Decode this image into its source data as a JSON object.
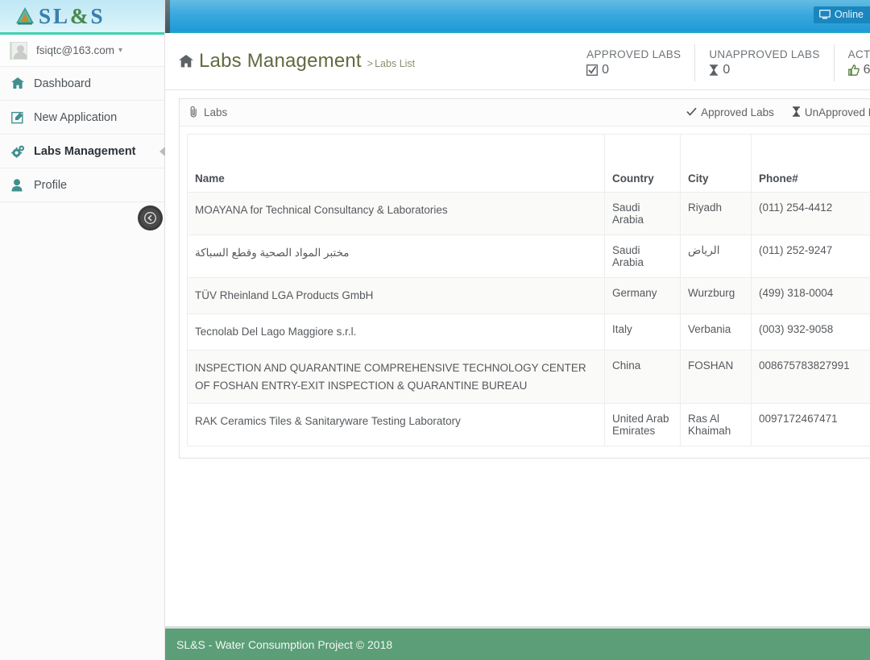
{
  "brand": {
    "name": "SL&S",
    "letters": [
      "S",
      "L",
      "&",
      "S"
    ],
    "logo_icon": "triangle-logo-icon"
  },
  "sidebar": {
    "user": {
      "email": "fsiqtc@163.com",
      "avatar_icon": "avatar-icon",
      "caret_icon": "chevron-down-icon"
    },
    "items": [
      {
        "label": "Dashboard",
        "icon": "home-icon",
        "active": false
      },
      {
        "label": "New Application",
        "icon": "edit-square-icon",
        "active": false
      },
      {
        "label": "Labs Management",
        "icon": "gears-icon",
        "active": true
      },
      {
        "label": "Profile",
        "icon": "user-icon",
        "active": false
      }
    ],
    "collapse_button": {
      "icon": "arrow-left-circle-icon",
      "label": ""
    }
  },
  "topbar": {
    "online_badge": {
      "label": "Online",
      "icon": "monitor-icon"
    }
  },
  "header": {
    "home_icon": "home-icon",
    "title": "Labs Management",
    "breadcrumb_sep": ">",
    "breadcrumb": "Labs List",
    "stats": [
      {
        "label": "APPROVED LABS",
        "value": "0",
        "icon": "check-square-icon"
      },
      {
        "label": "UNAPPROVED LABS",
        "value": "0",
        "icon": "hourglass-icon"
      },
      {
        "label": "ACTIVE LABS",
        "value": "6",
        "icon": "thumbs-up-icon"
      }
    ]
  },
  "panel": {
    "title": "Labs",
    "title_icon": "paperclip-icon",
    "actions": [
      {
        "label": "Approved Labs",
        "icon": "check-icon"
      },
      {
        "label": "UnApproved Labs",
        "icon": "hourglass-icon"
      }
    ]
  },
  "table": {
    "columns": [
      "Name",
      "Country",
      "City",
      "Phone#",
      ""
    ],
    "rows": [
      {
        "name": "MOAYANA for Technical Consultancy & Laboratories",
        "country": "Saudi Arabia",
        "city": "Riyadh",
        "phone": "(011) 254-4412",
        "extra": "",
        "rtl": false,
        "tall": "row-tall"
      },
      {
        "name": "مختبر المواد الصحية وقطع السباكة",
        "country": "Saudi Arabia",
        "city": "الرياض",
        "phone": "(011) 252-9247",
        "extra": "",
        "rtl": true,
        "tall": ""
      },
      {
        "name": "TÜV Rheinland LGA Products GmbH",
        "country": "Germany",
        "city": "Wurzburg",
        "phone": "(499) 318-0004",
        "extra": "",
        "rtl": false,
        "tall": ""
      },
      {
        "name": "Tecnolab Del Lago Maggiore s.r.l.",
        "country": "Italy",
        "city": "Verbania",
        "phone": "(003) 932-9058",
        "extra": "",
        "rtl": false,
        "tall": "row-tall"
      },
      {
        "name": "INSPECTION AND QUARANTINE COMPREHENSIVE TECHNOLOGY CENTER OF FOSHAN ENTRY-EXIT INSPECTION & QUARANTINE BUREAU",
        "country": "China",
        "city": "FOSHAN",
        "phone": "008675783827991",
        "extra": "",
        "rtl": false,
        "tall": ""
      },
      {
        "name": "RAK Ceramics Tiles & Sanitaryware Testing Laboratory",
        "country": "United Arab Emirates",
        "city": "Ras Al Khaimah",
        "phone": "0097172467471",
        "extra": "",
        "rtl": false,
        "tall": "row-tall2"
      }
    ]
  },
  "footer": {
    "text": "SL&S - Water Consumption Project © 2018"
  },
  "colors": {
    "topbar_blue": "#1e9ad6",
    "brand_teal": "#3fd0b0",
    "footer_green": "#5b9e77",
    "title_olive": "#5f6b3f",
    "icon_teal": "#3f8f8f"
  }
}
